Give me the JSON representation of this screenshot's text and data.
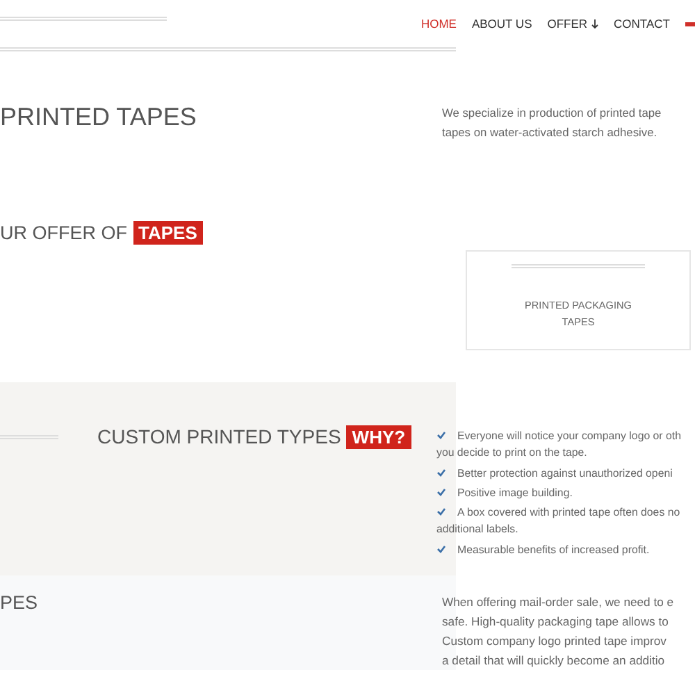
{
  "nav": {
    "items": [
      {
        "label": "HOME",
        "selected": true,
        "caret": false
      },
      {
        "label": "ABOUT US",
        "selected": false,
        "caret": false
      },
      {
        "label": "OFFER",
        "selected": false,
        "caret": true
      },
      {
        "label": "CONTACT",
        "selected": false,
        "caret": false
      }
    ]
  },
  "hero": {
    "title": "PRINTED TAPES",
    "text": [
      "We specialize in production of printed tape",
      "tapes on water-activated starch adhesive."
    ]
  },
  "offer": {
    "title": "UR OFFER OF",
    "highlight": "TAPES",
    "card": {
      "title": [
        "PRINTED PACKAGING",
        "TAPES"
      ]
    }
  },
  "why": {
    "title": "CUSTOM PRINTED TYPES",
    "highlight": "WHY?",
    "items": [
      [
        "Everyone will notice your company logo or oth",
        "you decide to print on the tape."
      ],
      [
        "Better protection against unauthorized openi"
      ],
      [
        "Positive image building."
      ],
      [
        "A box covered with printed tape often does no",
        "additional labels."
      ],
      [
        "Measurable benefits of increased profit."
      ]
    ]
  },
  "mail": {
    "title": "PES",
    "text": [
      "When offering mail-order sale, we need to e",
      "safe. High-quality packaging tape allows to",
      "Custom company logo printed tape improv",
      "a detail that will quickly become an additio"
    ]
  }
}
